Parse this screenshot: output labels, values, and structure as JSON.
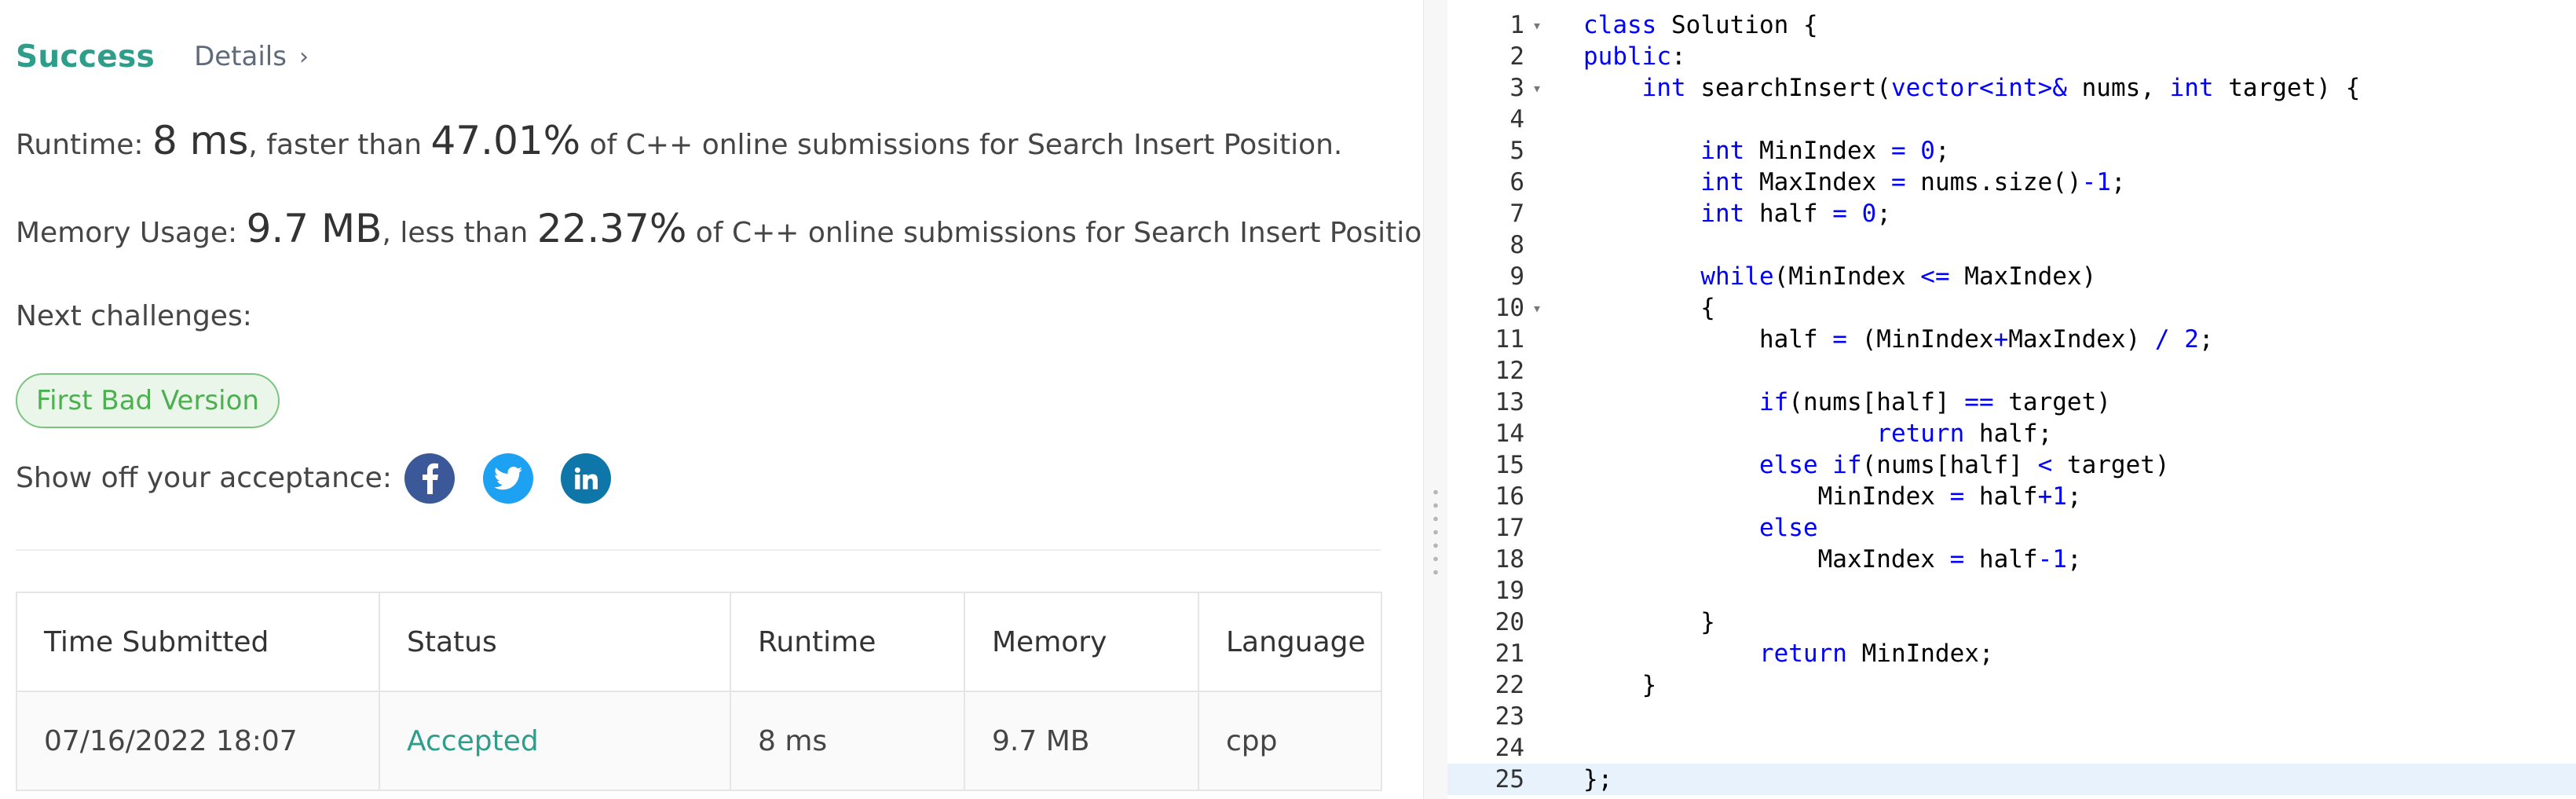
{
  "result": {
    "status": "Success",
    "details_label": "Details",
    "runtime_prefix": "Runtime: ",
    "runtime_value": "8 ms",
    "runtime_mid": ", faster than ",
    "runtime_percent": "47.01%",
    "runtime_suffix": " of C++ online submissions for Search Insert Position.",
    "memory_prefix": "Memory Usage: ",
    "memory_value": "9.7 MB",
    "memory_mid": ", less than ",
    "memory_percent": "22.37%",
    "memory_suffix": " of C++ online submissions for Search Insert Position.",
    "next_label": "Next challenges:",
    "next_challenge": "First Bad Version",
    "share_label": "Show off your acceptance:",
    "social_icons": [
      "facebook-icon",
      "twitter-icon",
      "linkedin-icon"
    ],
    "social_colors": {
      "facebook": "#3b5998",
      "twitter": "#1da1f2",
      "linkedin": "#0e76a8"
    }
  },
  "submissions": {
    "headers": [
      "Time Submitted",
      "Status",
      "Runtime",
      "Memory",
      "Language"
    ],
    "rows": [
      {
        "time": "07/16/2022 18:07",
        "status": "Accepted",
        "runtime": "8 ms",
        "memory": "9.7 MB",
        "language": "cpp"
      }
    ]
  },
  "editor": {
    "active_line": 25,
    "lines": [
      {
        "n": "1",
        "fold": true,
        "code": "class Solution {"
      },
      {
        "n": "2",
        "fold": false,
        "code": "public:"
      },
      {
        "n": "3",
        "fold": true,
        "code": "    int searchInsert(vector<int>& nums, int target) {"
      },
      {
        "n": "4",
        "fold": false,
        "code": ""
      },
      {
        "n": "5",
        "fold": false,
        "code": "        int MinIndex = 0;"
      },
      {
        "n": "6",
        "fold": false,
        "code": "        int MaxIndex = nums.size()-1;"
      },
      {
        "n": "7",
        "fold": false,
        "code": "        int half = 0;"
      },
      {
        "n": "8",
        "fold": false,
        "code": ""
      },
      {
        "n": "9",
        "fold": false,
        "code": "        while(MinIndex <= MaxIndex)"
      },
      {
        "n": "10",
        "fold": true,
        "code": "        {"
      },
      {
        "n": "11",
        "fold": false,
        "code": "            half = (MinIndex+MaxIndex) / 2;"
      },
      {
        "n": "12",
        "fold": false,
        "code": ""
      },
      {
        "n": "13",
        "fold": false,
        "code": "            if(nums[half] == target)"
      },
      {
        "n": "14",
        "fold": false,
        "code": "                    return half;"
      },
      {
        "n": "15",
        "fold": false,
        "code": "            else if(nums[half] < target)"
      },
      {
        "n": "16",
        "fold": false,
        "code": "                MinIndex = half+1;"
      },
      {
        "n": "17",
        "fold": false,
        "code": "            else"
      },
      {
        "n": "18",
        "fold": false,
        "code": "                MaxIndex = half-1;"
      },
      {
        "n": "19",
        "fold": false,
        "code": ""
      },
      {
        "n": "20",
        "fold": false,
        "code": "        }"
      },
      {
        "n": "21",
        "fold": false,
        "code": "            return MinIndex;"
      },
      {
        "n": "22",
        "fold": false,
        "code": "    }"
      },
      {
        "n": "23",
        "fold": false,
        "code": ""
      },
      {
        "n": "24",
        "fold": false,
        "code": ""
      },
      {
        "n": "25",
        "fold": false,
        "code": "};"
      }
    ]
  }
}
